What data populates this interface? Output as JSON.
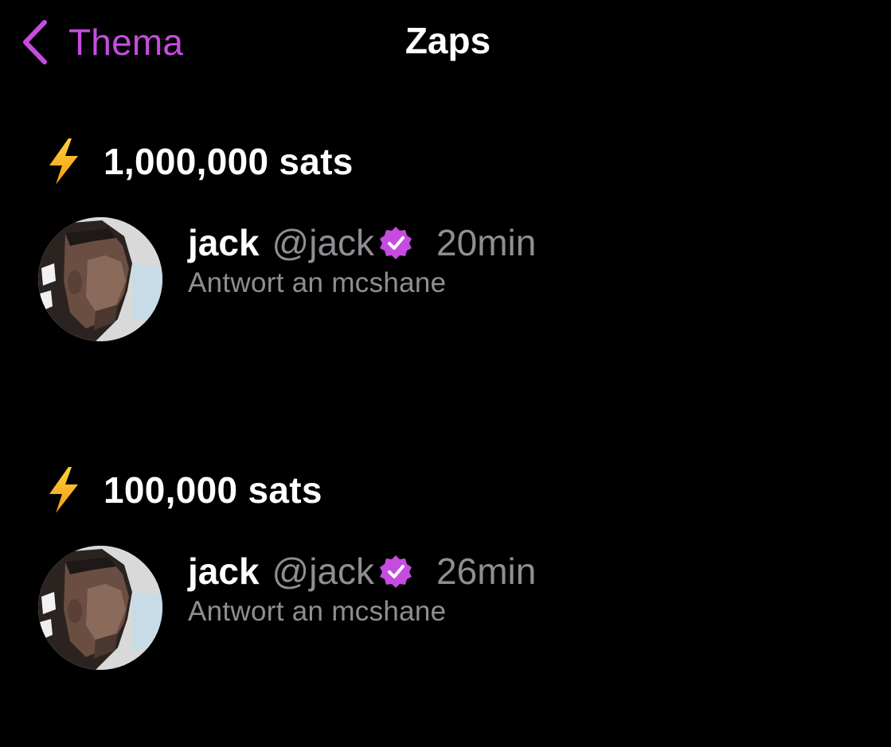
{
  "colors": {
    "background": "#000000",
    "accent": "#c64ce0",
    "primary_text": "#ffffff",
    "secondary_text": "#8e8e93",
    "lightning": "#f7b81f"
  },
  "header": {
    "back_label": "Thema",
    "back_icon": "chevron-left-icon",
    "title": "Zaps"
  },
  "zaps": [
    {
      "amount": "1,000,000 sats",
      "icon": "lightning-bolt-icon",
      "user": {
        "name": "jack",
        "handle": "@jack",
        "verified_icon": "verified-badge-icon"
      },
      "time": "20min",
      "reply_text": "Antwort an mcshane"
    },
    {
      "amount": "100,000 sats",
      "icon": "lightning-bolt-icon",
      "user": {
        "name": "jack",
        "handle": "@jack",
        "verified_icon": "verified-badge-icon"
      },
      "time": "26min",
      "reply_text": "Antwort an mcshane"
    }
  ]
}
